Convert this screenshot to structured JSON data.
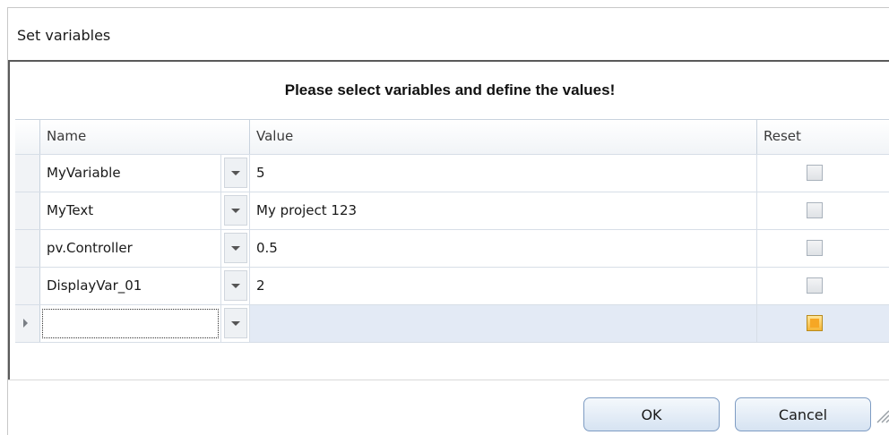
{
  "dialog": {
    "title": "Set variables",
    "heading": "Please select variables and define the values!",
    "columns": {
      "name": "Name",
      "value": "Value",
      "reset": "Reset"
    },
    "rows": [
      {
        "name": "MyVariable",
        "value": "5",
        "reset": false
      },
      {
        "name": "MyText",
        "value": "My project 123",
        "reset": false
      },
      {
        "name": "pv.Controller",
        "value": "0.5",
        "reset": false
      },
      {
        "name": "DisplayVar_01",
        "value": "2",
        "reset": false
      }
    ],
    "new_row": {
      "name": "",
      "value": ""
    },
    "ok_label": "OK",
    "cancel_label": "Cancel"
  },
  "icons": {
    "dropdown": "chevron-down-icon",
    "row_pointer": "triangle-right-icon",
    "resize_grip": "resize-grip-icon"
  },
  "colors": {
    "button_border": "#7e9cc3",
    "selected_row": "#e3eaf5",
    "active_checkbox": "#f6a724"
  }
}
